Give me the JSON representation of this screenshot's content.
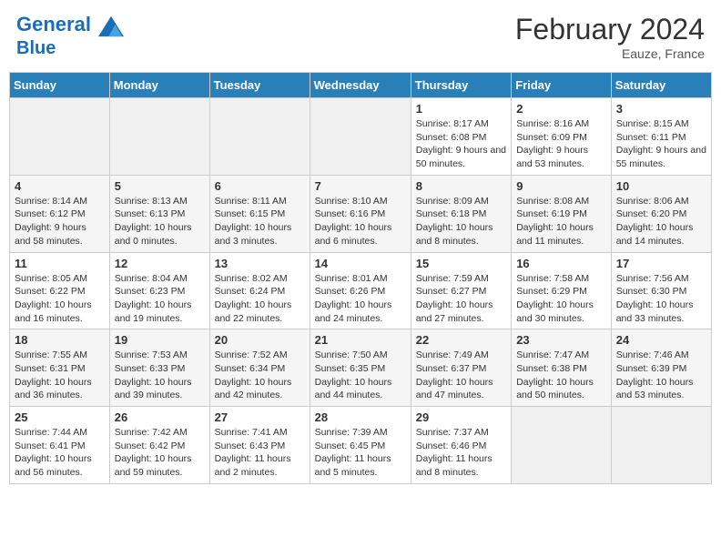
{
  "header": {
    "logo_line1": "General",
    "logo_line2": "Blue",
    "month_year": "February 2024",
    "location": "Eauze, France"
  },
  "weekdays": [
    "Sunday",
    "Monday",
    "Tuesday",
    "Wednesday",
    "Thursday",
    "Friday",
    "Saturday"
  ],
  "weeks": [
    [
      {
        "day": "",
        "info": ""
      },
      {
        "day": "",
        "info": ""
      },
      {
        "day": "",
        "info": ""
      },
      {
        "day": "",
        "info": ""
      },
      {
        "day": "1",
        "info": "Sunrise: 8:17 AM\nSunset: 6:08 PM\nDaylight: 9 hours and 50 minutes."
      },
      {
        "day": "2",
        "info": "Sunrise: 8:16 AM\nSunset: 6:09 PM\nDaylight: 9 hours and 53 minutes."
      },
      {
        "day": "3",
        "info": "Sunrise: 8:15 AM\nSunset: 6:11 PM\nDaylight: 9 hours and 55 minutes."
      }
    ],
    [
      {
        "day": "4",
        "info": "Sunrise: 8:14 AM\nSunset: 6:12 PM\nDaylight: 9 hours and 58 minutes."
      },
      {
        "day": "5",
        "info": "Sunrise: 8:13 AM\nSunset: 6:13 PM\nDaylight: 10 hours and 0 minutes."
      },
      {
        "day": "6",
        "info": "Sunrise: 8:11 AM\nSunset: 6:15 PM\nDaylight: 10 hours and 3 minutes."
      },
      {
        "day": "7",
        "info": "Sunrise: 8:10 AM\nSunset: 6:16 PM\nDaylight: 10 hours and 6 minutes."
      },
      {
        "day": "8",
        "info": "Sunrise: 8:09 AM\nSunset: 6:18 PM\nDaylight: 10 hours and 8 minutes."
      },
      {
        "day": "9",
        "info": "Sunrise: 8:08 AM\nSunset: 6:19 PM\nDaylight: 10 hours and 11 minutes."
      },
      {
        "day": "10",
        "info": "Sunrise: 8:06 AM\nSunset: 6:20 PM\nDaylight: 10 hours and 14 minutes."
      }
    ],
    [
      {
        "day": "11",
        "info": "Sunrise: 8:05 AM\nSunset: 6:22 PM\nDaylight: 10 hours and 16 minutes."
      },
      {
        "day": "12",
        "info": "Sunrise: 8:04 AM\nSunset: 6:23 PM\nDaylight: 10 hours and 19 minutes."
      },
      {
        "day": "13",
        "info": "Sunrise: 8:02 AM\nSunset: 6:24 PM\nDaylight: 10 hours and 22 minutes."
      },
      {
        "day": "14",
        "info": "Sunrise: 8:01 AM\nSunset: 6:26 PM\nDaylight: 10 hours and 24 minutes."
      },
      {
        "day": "15",
        "info": "Sunrise: 7:59 AM\nSunset: 6:27 PM\nDaylight: 10 hours and 27 minutes."
      },
      {
        "day": "16",
        "info": "Sunrise: 7:58 AM\nSunset: 6:29 PM\nDaylight: 10 hours and 30 minutes."
      },
      {
        "day": "17",
        "info": "Sunrise: 7:56 AM\nSunset: 6:30 PM\nDaylight: 10 hours and 33 minutes."
      }
    ],
    [
      {
        "day": "18",
        "info": "Sunrise: 7:55 AM\nSunset: 6:31 PM\nDaylight: 10 hours and 36 minutes."
      },
      {
        "day": "19",
        "info": "Sunrise: 7:53 AM\nSunset: 6:33 PM\nDaylight: 10 hours and 39 minutes."
      },
      {
        "day": "20",
        "info": "Sunrise: 7:52 AM\nSunset: 6:34 PM\nDaylight: 10 hours and 42 minutes."
      },
      {
        "day": "21",
        "info": "Sunrise: 7:50 AM\nSunset: 6:35 PM\nDaylight: 10 hours and 44 minutes."
      },
      {
        "day": "22",
        "info": "Sunrise: 7:49 AM\nSunset: 6:37 PM\nDaylight: 10 hours and 47 minutes."
      },
      {
        "day": "23",
        "info": "Sunrise: 7:47 AM\nSunset: 6:38 PM\nDaylight: 10 hours and 50 minutes."
      },
      {
        "day": "24",
        "info": "Sunrise: 7:46 AM\nSunset: 6:39 PM\nDaylight: 10 hours and 53 minutes."
      }
    ],
    [
      {
        "day": "25",
        "info": "Sunrise: 7:44 AM\nSunset: 6:41 PM\nDaylight: 10 hours and 56 minutes."
      },
      {
        "day": "26",
        "info": "Sunrise: 7:42 AM\nSunset: 6:42 PM\nDaylight: 10 hours and 59 minutes."
      },
      {
        "day": "27",
        "info": "Sunrise: 7:41 AM\nSunset: 6:43 PM\nDaylight: 11 hours and 2 minutes."
      },
      {
        "day": "28",
        "info": "Sunrise: 7:39 AM\nSunset: 6:45 PM\nDaylight: 11 hours and 5 minutes."
      },
      {
        "day": "29",
        "info": "Sunrise: 7:37 AM\nSunset: 6:46 PM\nDaylight: 11 hours and 8 minutes."
      },
      {
        "day": "",
        "info": ""
      },
      {
        "day": "",
        "info": ""
      }
    ]
  ]
}
